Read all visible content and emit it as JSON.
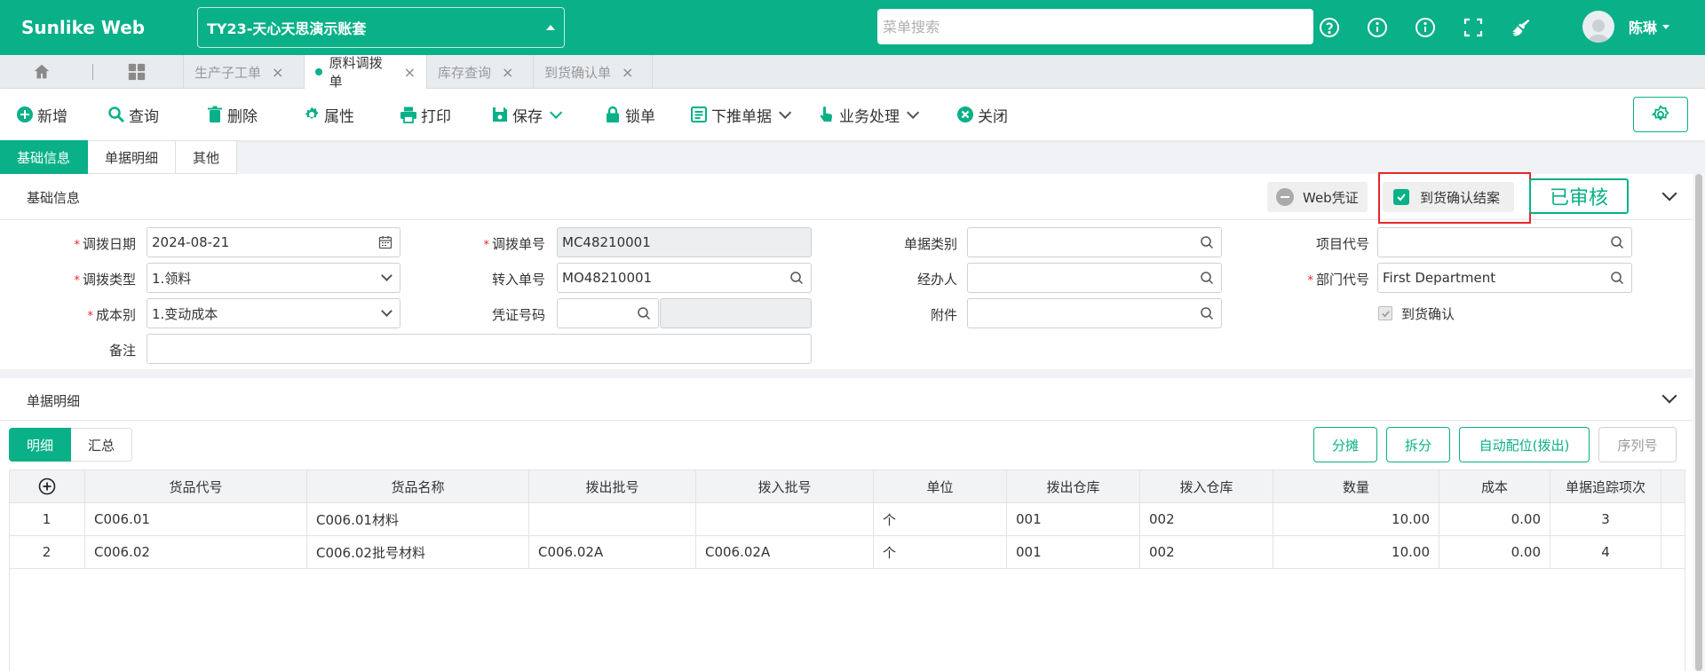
{
  "header": {
    "brand": "Sunlike Web",
    "account": "TY23-天心天思演示账套",
    "search_placeholder": "菜单搜索",
    "user_name": "陈琳"
  },
  "tabs": {
    "items": [
      {
        "label": "生产子工单",
        "active": false
      },
      {
        "label": "原料调拨单",
        "active": true
      },
      {
        "label": "库存查询",
        "active": false
      },
      {
        "label": "到货确认单",
        "active": false
      }
    ],
    "close_glyph": "×"
  },
  "toolbar": {
    "new": "新增",
    "query": "查询",
    "delete": "删除",
    "properties": "属性",
    "print": "打印",
    "save": "保存",
    "lock": "锁单",
    "push_down": "下推单据",
    "business": "业务处理",
    "close": "关闭"
  },
  "section_tabs": [
    "基础信息",
    "单据明细",
    "其他"
  ],
  "basic": {
    "title": "基础信息",
    "web_voucher": "Web凭证",
    "arrival_close": "到货确认结案",
    "status": "已审核",
    "fields": {
      "transfer_date": {
        "label": "调拨日期",
        "value": "2024-08-21"
      },
      "transfer_no": {
        "label": "调拨单号",
        "value": "MC48210001"
      },
      "doc_category": {
        "label": "单据类别",
        "value": ""
      },
      "project_code": {
        "label": "项目代号",
        "value": ""
      },
      "transfer_type": {
        "label": "调拨类型",
        "value": "1.领料"
      },
      "transfer_in_no": {
        "label": "转入单号",
        "value": "MO48210001"
      },
      "handler": {
        "label": "经办人",
        "value": ""
      },
      "dept_code": {
        "label": "部门代号",
        "value": "First Department"
      },
      "cost_type": {
        "label": "成本别",
        "value": "1.变动成本"
      },
      "voucher_no": {
        "label": "凭证号码",
        "value": ""
      },
      "attachment": {
        "label": "附件",
        "value": ""
      },
      "arrival_confirm": {
        "label": "到货确认"
      },
      "remark": {
        "label": "备注",
        "value": ""
      }
    },
    "required_mark": "*"
  },
  "detail": {
    "title": "单据明细",
    "sub_tabs": [
      "明细",
      "汇总"
    ],
    "buttons": {
      "split_share": "分摊",
      "split": "拆分",
      "auto_locate": "自动配位(拨出)",
      "serial": "序列号"
    },
    "columns": [
      "货品代号",
      "货品名称",
      "拨出批号",
      "拨入批号",
      "单位",
      "拨出仓库",
      "拨入仓库",
      "数量",
      "成本",
      "单据追踪项次"
    ],
    "rows": [
      {
        "no": "1",
        "code": "C006.01",
        "name": "C006.01材料",
        "out_batch": "",
        "in_batch": "",
        "unit": "个",
        "out_wh": "001",
        "in_wh": "002",
        "qty": "10.00",
        "cost": "0.00",
        "trace": "3"
      },
      {
        "no": "2",
        "code": "C006.02",
        "name": "C006.02批号材料",
        "out_batch": "C006.02A",
        "in_batch": "C006.02A",
        "unit": "个",
        "out_wh": "001",
        "in_wh": "002",
        "qty": "10.00",
        "cost": "0.00",
        "trace": "4"
      }
    ]
  }
}
